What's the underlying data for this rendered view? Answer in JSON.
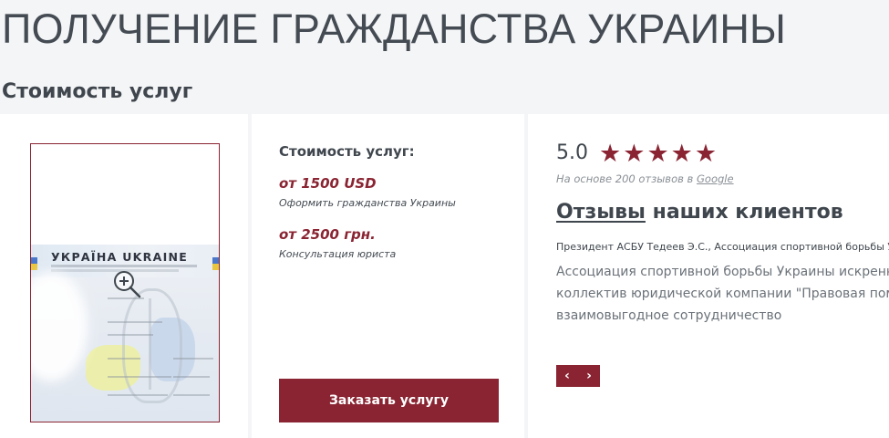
{
  "page": {
    "title": "ПОЛУЧЕНИЕ ГРАЖДАНСТВА УКРАИНЫ",
    "section_title": "Стоимость услуг"
  },
  "image_panel": {
    "passport_heading": "УКРАЇНА UKRAINE",
    "zoom_icon": "zoom-in-icon"
  },
  "pricing": {
    "heading": "Стоимость услуг:",
    "items": [
      {
        "price": "от 1500 USD",
        "description": "Оформить гражданства Украины"
      },
      {
        "price": "от 2500 грн.",
        "description": "Консультация юриста"
      }
    ],
    "order_button_label": "Заказать услугу"
  },
  "reviews": {
    "score": "5.0",
    "stars": 5,
    "rating_note": "На основе 200 отзывов в ",
    "rating_source": "Google",
    "heading_link": "Отзывы",
    "heading_rest": " наших клиентов",
    "author": "Президент АСБУ Тедеев Э.С., Ассоциация спортивной борьбы Украины",
    "text_lines": [
      "Ассоциация спортивной борьбы Украины искренне благодарит",
      "коллектив юридической компании \"Правовая помощь\" за",
      "взаимовыгодное сотрудничество"
    ],
    "prev_label": "‹",
    "next_label": "›"
  },
  "colors": {
    "accent": "#8a2432",
    "background": "#f4f5f7",
    "panel": "#ffffff",
    "text": "#3f464d"
  }
}
